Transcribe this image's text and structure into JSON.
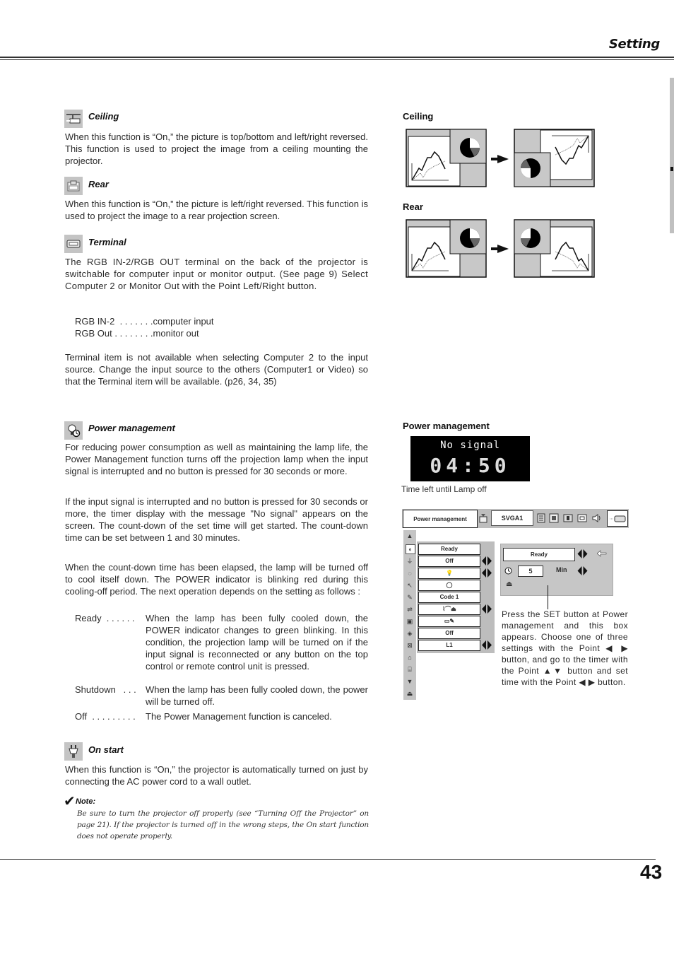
{
  "header": {
    "section_title": "Setting",
    "page_number": "43"
  },
  "sections": {
    "ceiling": {
      "icon": "ceiling-icon",
      "title": "Ceiling",
      "text": "When this function is “On,” the picture is top/bottom and left/right reversed.  This function is used to project the image from a ceiling mounting the  projector."
    },
    "rear": {
      "icon": "rear-icon",
      "title": "Rear",
      "text": "When this function is “On,” the picture is left/right reversed.  This function is used to project the image to a rear projection screen."
    },
    "terminal": {
      "icon": "terminal-icon",
      "title": "Terminal",
      "text": "The RGB IN-2/RGB OUT terminal on the back of the projector is switchable for computer input or monitor output.  (See page 9) Select Computer 2 or Monitor Out with the Point Left/Right button.",
      "options": [
        "RGB IN-2  . . . . . . .computer input",
        "RGB Out . . . . . . . .monitor out"
      ],
      "text2": "Terminal item is not available when selecting Computer 2 to the input source.  Change the input source to the others (Computer1 or Video) so that the Terminal item will be available.  (p26, 34, 35)"
    },
    "power_management": {
      "icon": "power-management-icon",
      "title": "Power management",
      "p1": "For reducing power consumption as well as maintaining the lamp life, the Power Management function turns off the projection lamp when the input signal is interrupted and no button is pressed for 30 seconds or more.",
      "p2": "If the input signal is interrupted and no button is pressed for 30 seconds or more, the timer display with the message \"No signal\" appears on the screen. The count-down of the set time will get started. The count-down time can be set between 1 and 30 minutes.",
      "p3": "When the count-down time has been elapsed, the lamp will be turned off to cool itself down. The POWER indicator is blinking red during this cooling-off period. The next operation depends on the setting as follows :",
      "modes": [
        {
          "term": "Ready  . . . . . .",
          "desc": "When the lamp has been fully cooled down, the POWER indicator changes to green blinking. In this condition, the projection lamp will be turned on if the input signal is reconnected or any button on the top control or remote control unit is pressed."
        },
        {
          "term": "Shutdown   . . .",
          "desc": "When the lamp has been fully cooled down, the power will be turned off."
        },
        {
          "term": "Off  . . . . . . . . .",
          "desc": "The Power Management function is canceled."
        }
      ]
    },
    "on_start": {
      "icon": "on-start-icon",
      "title": "On start",
      "text": "When this function is “On,” the projector is automatically turned on just by connecting the AC power cord to a wall outlet.",
      "note_label": "Note:",
      "note_text": "Be sure to turn the projector off properly (see “Turning Off the  Projector” on page 21).  If the projector is turned off in the wrong steps, the On start function does not operate properly."
    }
  },
  "figures": {
    "ceiling_label": "Ceiling",
    "rear_label": "Rear",
    "power_label": "Power management",
    "no_signal": {
      "message": "No signal",
      "timer": "04:50",
      "caption": "Time left until Lamp off"
    },
    "menu": {
      "title": "Power management",
      "signal": "SVGA1",
      "items": [
        "Ready",
        "Off",
        "",
        "",
        "Code 1",
        "",
        "",
        "Off",
        "L1"
      ],
      "items_with_arrows": [
        false,
        true,
        true,
        false,
        false,
        true,
        false,
        false,
        true
      ]
    },
    "pm_box": {
      "mode": "Ready",
      "timer_value": "5",
      "timer_unit": "Min",
      "note": "Press the SET button at Power management and this box appears.  Choose one of three settings with the Point ◀ ▶ button, and go to the timer with the Point ▲▼ button and set time with the Point ◀ ▶ button."
    }
  }
}
